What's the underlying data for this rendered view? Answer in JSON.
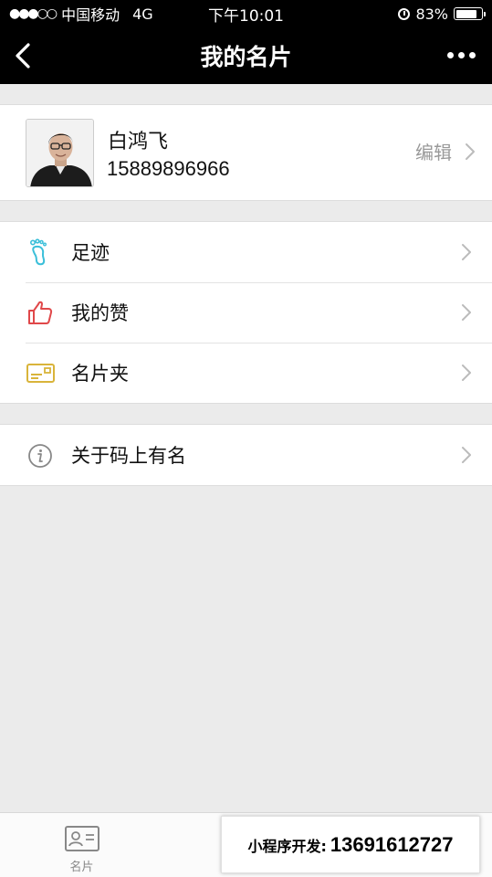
{
  "status_bar": {
    "signal": "●●●○○",
    "carrier": "中国移动",
    "network": "4G",
    "time": "下午10:01",
    "battery_percent_text": "83%",
    "battery_level": 0.83
  },
  "nav": {
    "title": "我的名片"
  },
  "profile": {
    "name": "白鸿飞",
    "phone": "15889896966",
    "edit_label": "编辑"
  },
  "menu": {
    "items": [
      {
        "label": "足迹",
        "icon": "footprint-icon",
        "color": "#3bbfd9"
      },
      {
        "label": "我的赞",
        "icon": "thumbs-up-icon",
        "color": "#e0484a"
      },
      {
        "label": "名片夹",
        "icon": "card-holder-icon",
        "color": "#d9b43a"
      }
    ]
  },
  "about": {
    "label": "关于码上有名",
    "icon": "info-icon"
  },
  "tabs": [
    {
      "label": "名片",
      "icon": "card-icon"
    }
  ],
  "promo": {
    "label": "小程序开发:",
    "phone": "13691612727"
  }
}
